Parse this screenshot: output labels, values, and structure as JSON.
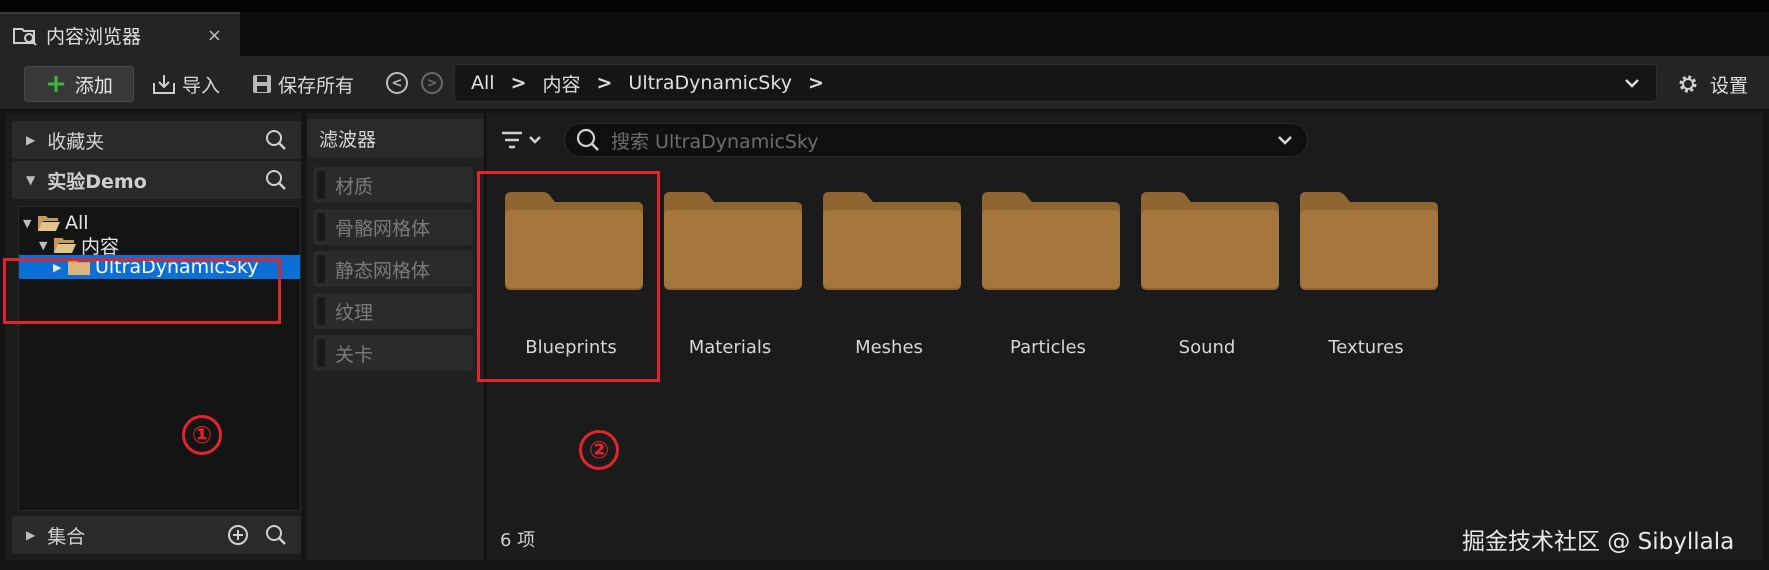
{
  "tab": {
    "title": "内容浏览器",
    "close": "×"
  },
  "toolbar": {
    "add_label": "添加",
    "import_label": "导入",
    "save_all_label": "保存所有",
    "settings_label": "设置",
    "breadcrumb": [
      "All",
      "内容",
      "UltraDynamicSky"
    ]
  },
  "left_panel": {
    "favorites_label": "收藏夹",
    "project_label": "实验Demo",
    "collections_label": "集合",
    "tree": [
      {
        "label": "All",
        "expanded": true
      },
      {
        "label": "内容",
        "expanded": true
      },
      {
        "label": "UltraDynamicSky",
        "selected": true
      }
    ]
  },
  "filters": {
    "title": "滤波器",
    "items": [
      "材质",
      "骨骼网格体",
      "静态网格体",
      "纹理",
      "关卡"
    ]
  },
  "content": {
    "search_placeholder": "搜索 UltraDynamicSky",
    "folders": [
      "Blueprints",
      "Materials",
      "Meshes",
      "Particles",
      "Sound",
      "Textures"
    ],
    "item_count": "6 项"
  },
  "annotations": {
    "marker1": "①",
    "marker2": "②"
  },
  "watermark": "掘金技术社区 @ Sibyllala",
  "colors": {
    "selection": "#0c6fd6",
    "folder": "#a4763e",
    "annotation_red": "#e0262c",
    "add_green": "#3fb83f"
  }
}
